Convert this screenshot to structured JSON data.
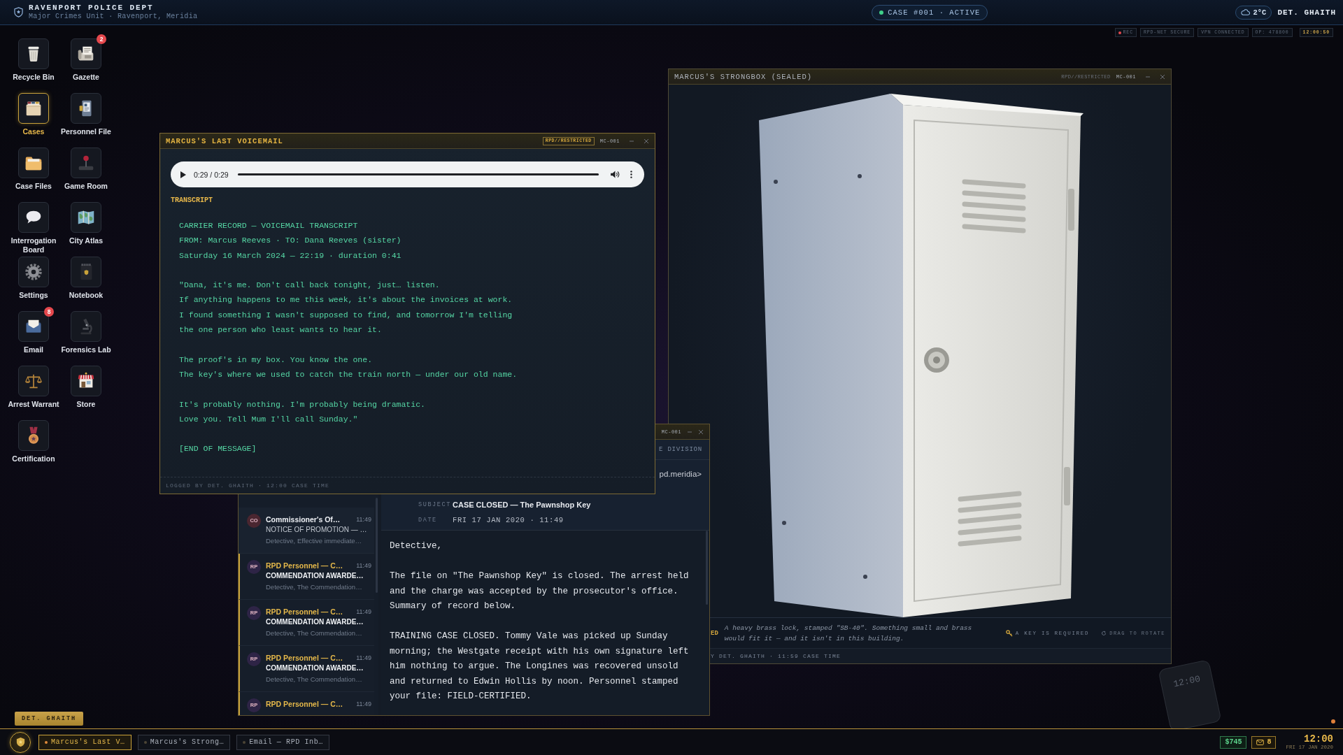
{
  "top_bar": {
    "title": "RAVENPORT POLICE DEPT",
    "subtitle": "Major Crimes Unit · Ravenport, Meridia",
    "case_status": "CASE #001 · ACTIVE",
    "temperature": "2°C",
    "user": "DET. GHAITH"
  },
  "status_chips": [
    {
      "label": "REC",
      "kind": "recording"
    },
    {
      "label": "RPD-NET SECURE",
      "kind": "plain"
    },
    {
      "label": "VPN CONNECTED",
      "kind": "plain"
    },
    {
      "label": "OP: 478800",
      "kind": "plain"
    },
    {
      "label": "12:00:50",
      "kind": "clock"
    }
  ],
  "desktop_icons": [
    {
      "label": "Recycle Bin",
      "selected": false
    },
    {
      "label": "Cases",
      "selected": true
    },
    {
      "label": "Case Files",
      "selected": false
    },
    {
      "label": "Interrogation Board",
      "selected": false
    },
    {
      "label": "Settings",
      "selected": false
    },
    {
      "label": "Email",
      "selected": false,
      "badge": "8"
    },
    {
      "label": "Arrest Warrant",
      "selected": false
    },
    {
      "label": "Certification",
      "selected": false
    },
    {
      "label": "Gazette",
      "selected": false,
      "badge": "2"
    },
    {
      "label": "Personnel File",
      "selected": false
    },
    {
      "label": "Game Room",
      "selected": false
    },
    {
      "label": "City Atlas",
      "selected": false
    },
    {
      "label": "Notebook",
      "selected": false
    },
    {
      "label": "Forensics Lab",
      "selected": false
    },
    {
      "label": "Store",
      "selected": false
    }
  ],
  "desk_tag": "DET. GHAITH",
  "strongbox_window": {
    "title": "MARCUS'S STRONGBOX (SEALED)",
    "classification": "RPD//RESTRICTED",
    "ref": "MC-001",
    "active": false,
    "badge_fragment": "ED",
    "description": "A heavy brass lock, stamped \"SB-40\". Something small and brass would fit it — and it isn't in this building.",
    "requirement": "A KEY IS REQUIRED",
    "hint": "DRAG TO ROTATE",
    "footer_fragment": "Y DET. GHAITH · 11:59 CASE TIME"
  },
  "email_window": {
    "ref": "MC-001",
    "active": false,
    "header_fragment": "E DIVISION",
    "from_fragment": "pd.meridia>",
    "messages": [
      {
        "initials": "CO",
        "color": "#4a2630",
        "sender": "Commissioner's Of…",
        "time": "11:49",
        "subject": "NOTICE OF PROMOTION — …",
        "preview": "Detective, Effective immediate…",
        "unread": false
      },
      {
        "initials": "RP",
        "color": "#2e2446",
        "sender": "RPD Personnel — C…",
        "time": "11:49",
        "subject": "COMMENDATION AWARDE…",
        "preview": "Detective, The Commendation…",
        "unread": true
      },
      {
        "initials": "RP",
        "color": "#2e2446",
        "sender": "RPD Personnel — C…",
        "time": "11:49",
        "subject": "COMMENDATION AWARDE…",
        "preview": "Detective, The Commendation…",
        "unread": true
      },
      {
        "initials": "RP",
        "color": "#2e2446",
        "sender": "RPD Personnel — C…",
        "time": "11:49",
        "subject": "COMMENDATION AWARDE…",
        "preview": "Detective, The Commendation…",
        "unread": true
      },
      {
        "initials": "RP",
        "color": "#2e2446",
        "sender": "RPD Personnel — C…",
        "time": "11:49",
        "unread": true
      }
    ],
    "subject_label": "SUBJECT",
    "subject": "CASE CLOSED — The Pawnshop Key",
    "date_label": "DATE",
    "date": "FRI 17 JAN 2020 · 11:49",
    "body": [
      "Detective,",
      "The file on \"The Pawnshop Key\" is closed. The arrest held and the charge was accepted by the prosecutor's office. Summary of record below.",
      "TRAINING CASE CLOSED. Tommy Vale was picked up Sunday morning; the Westgate receipt with his own signature left him nothing to argue. The Longines was recovered unsold and returned to Edwin Hollis by noon. Personnel stamped your file: FIELD-CERTIFIED."
    ]
  },
  "voicemail_window": {
    "title": "MARCUS'S LAST VOICEMAIL",
    "classification": "RPD//RESTRICTED",
    "ref": "MC-001",
    "active": true,
    "player": {
      "time": "0:29 / 0:29",
      "level": 1
    },
    "transcript_label": "TRANSCRIPT",
    "transcript": [
      "CARRIER RECORD — VOICEMAIL TRANSCRIPT\nFROM: Marcus Reeves · TO: Dana Reeves (sister)\nSaturday 16 March 2024 — 22:19 · duration 0:41",
      "\"Dana, it's me. Don't call back tonight, just… listen.\nIf anything happens to me this week, it's about the invoices at work.\nI found something I wasn't supposed to find, and tomorrow I'm telling\nthe one person who least wants to hear it.",
      "The proof's in my box. You know the one.\nThe key's where we used to catch the train north — under our old name.",
      "It's probably nothing. I'm probably being dramatic.\nLove you. Tell Mum I'll call Sunday.\"",
      "[END OF MESSAGE]"
    ],
    "footer": "LOGGED BY DET. GHAITH · 12:00 CASE TIME"
  },
  "phone": {
    "clock": "12:00"
  },
  "taskbar": {
    "tasks": [
      {
        "label": "Marcus's Last V…",
        "selected": true
      },
      {
        "label": "Marcus's Strong…",
        "selected": false
      },
      {
        "label": "Email — RPD Inb…",
        "selected": false
      }
    ],
    "balance": "$745",
    "mail_count": "8",
    "clock": "12:00",
    "date": "FRI 17 JAN 2020"
  }
}
